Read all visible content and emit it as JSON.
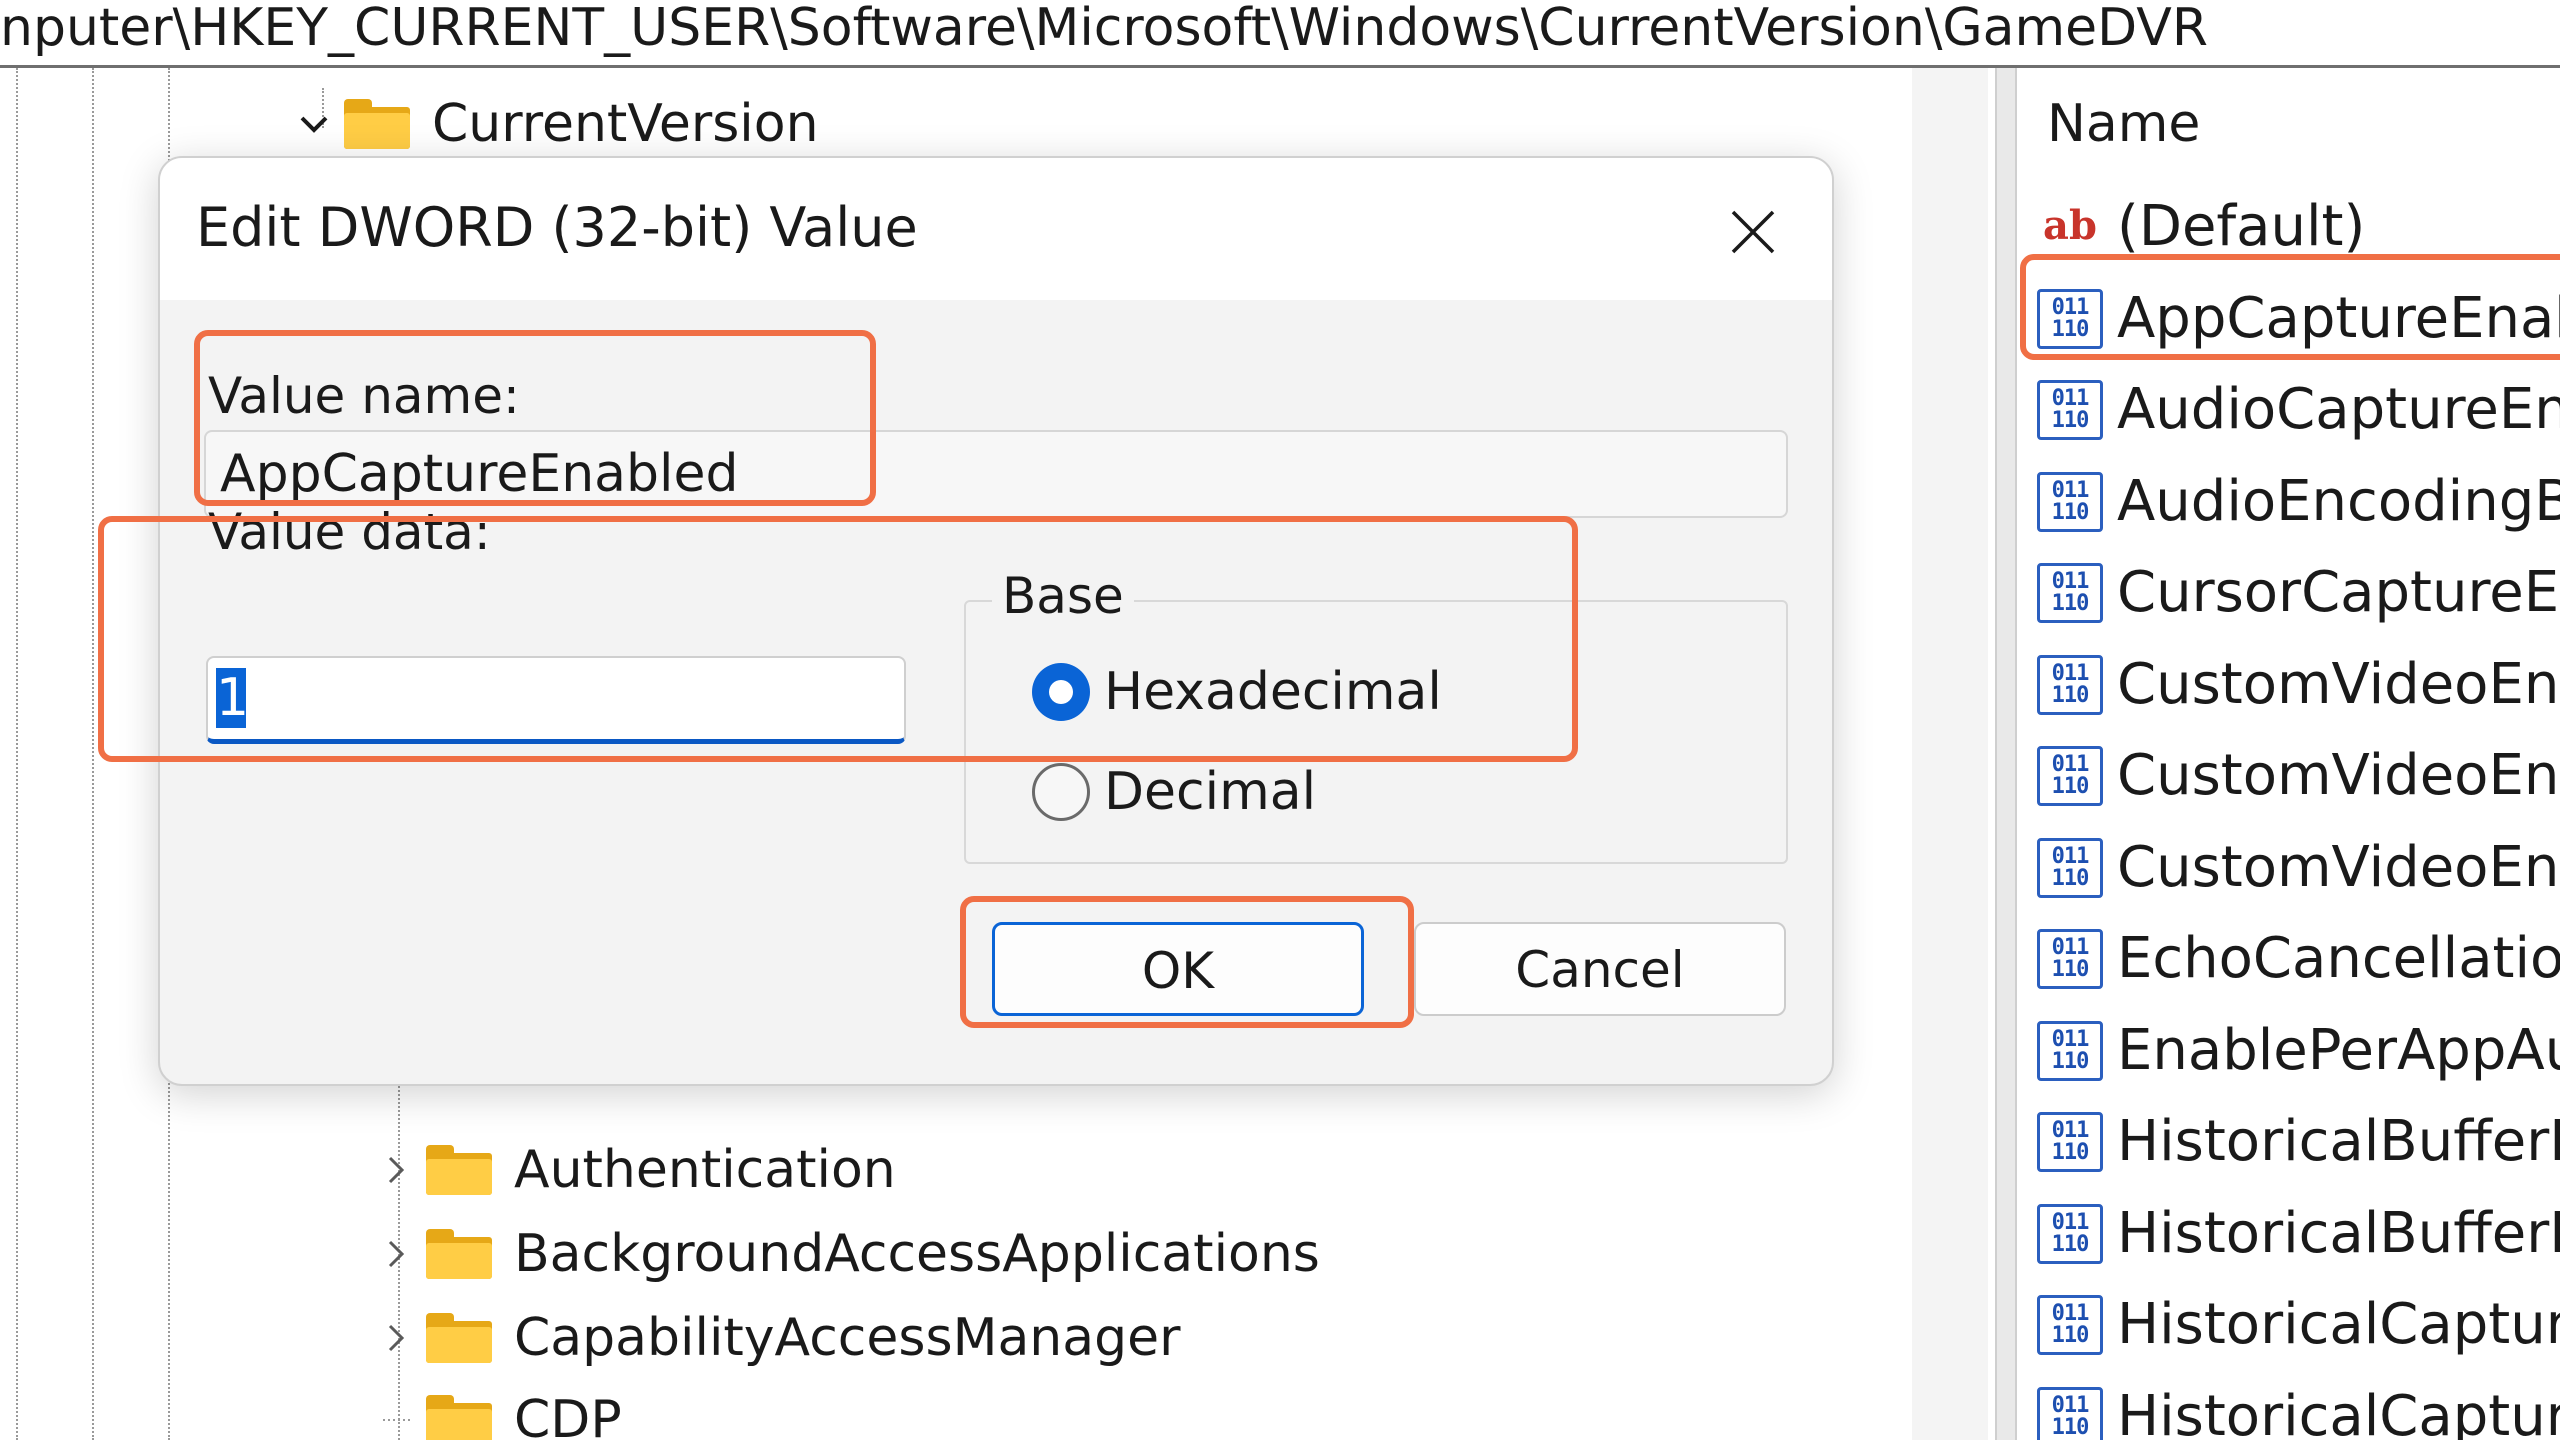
{
  "address_bar": {
    "path": "nputer\\HKEY_CURRENT_USER\\Software\\Microsoft\\Windows\\CurrentVersion\\GameDVR"
  },
  "tree": {
    "top_item": "CurrentVersion",
    "items": [
      {
        "label": "Authentication",
        "expanded": false
      },
      {
        "label": "BackgroundAccessApplications",
        "expanded": false
      },
      {
        "label": "CapabilityAccessManager",
        "expanded": false
      },
      {
        "label": "CDP",
        "expanded": false
      }
    ]
  },
  "values_pane": {
    "column_header": "Name",
    "rows": [
      {
        "name": "(Default)",
        "icon": "string-value-icon"
      },
      {
        "name": "AppCaptureEnab...",
        "icon": "binary-value-icon"
      },
      {
        "name": "AudioCaptureEn...",
        "icon": "binary-value-icon"
      },
      {
        "name": "AudioEncodingB...",
        "icon": "binary-value-icon"
      },
      {
        "name": "CursorCaptureEn...",
        "icon": "binary-value-icon"
      },
      {
        "name": "CustomVideoEnc...",
        "icon": "binary-value-icon"
      },
      {
        "name": "CustomVideoEnc...",
        "icon": "binary-value-icon"
      },
      {
        "name": "CustomVideoEnc...",
        "icon": "binary-value-icon"
      },
      {
        "name": "EchoCancellatio...",
        "icon": "binary-value-icon"
      },
      {
        "name": "EnablePerAppAu...",
        "icon": "binary-value-icon"
      },
      {
        "name": "HistoricalBufferL...",
        "icon": "binary-value-icon"
      },
      {
        "name": "HistoricalBufferL...",
        "icon": "binary-value-icon"
      },
      {
        "name": "HistoricalCaptur...",
        "icon": "binary-value-icon"
      },
      {
        "name": "HistoricalCaptur...",
        "icon": "binary-value-icon"
      }
    ]
  },
  "dialog": {
    "title": "Edit DWORD (32-bit) Value",
    "value_name_label": "Value name:",
    "value_name": "AppCaptureEnabled",
    "value_data_label": "Value data:",
    "value_data": "1",
    "base_label": "Base",
    "base_options": [
      {
        "label": "Hexadecimal",
        "selected": true
      },
      {
        "label": "Decimal",
        "selected": false
      }
    ],
    "ok_label": "OK",
    "cancel_label": "Cancel"
  },
  "colors": {
    "highlight": "#f06f45",
    "accent": "#0a64d6",
    "folder": "#ffcd45"
  }
}
